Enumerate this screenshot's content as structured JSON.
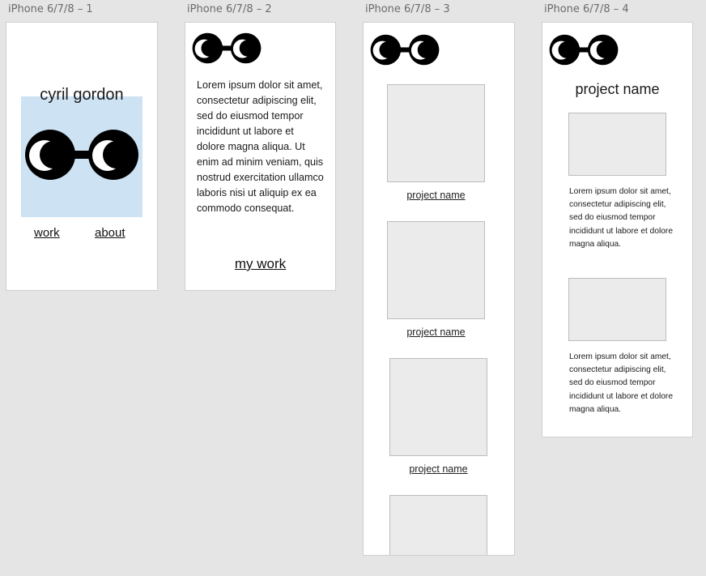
{
  "artboards": [
    {
      "label": "iPhone 6/7/8 – 1"
    },
    {
      "label": "iPhone 6/7/8 – 2"
    },
    {
      "label": "iPhone 6/7/8 – 3"
    },
    {
      "label": "iPhone 6/7/8 – 4"
    }
  ],
  "home": {
    "name": "cyril gordon",
    "nav": {
      "work": "work",
      "about": "about"
    },
    "hero_color": "#cde3f4"
  },
  "about": {
    "bio": "Lorem ipsum dolor sit amet, consectetur adipiscing elit, sed do eiusmod tempor incididunt ut labore et dolore magna aliqua. Ut enim ad minim veniam, quis nostrud exercitation ullamco laboris nisi ut aliquip ex ea commodo consequat.",
    "cta": "my work"
  },
  "work": {
    "projects": [
      {
        "label": "project name"
      },
      {
        "label": "project name"
      },
      {
        "label": "project name"
      }
    ]
  },
  "project": {
    "title": "project name",
    "descriptions": [
      "Lorem ipsum dolor sit amet, consectetur adipiscing elit, sed do eiusmod tempor incididunt ut labore et dolore magna aliqua.",
      "Lorem ipsum dolor sit amet, consectetur adipiscing elit, sed do eiusmod tempor incididunt ut labore et dolore magna aliqua."
    ]
  },
  "icons": {
    "logo": "glasses-icon"
  },
  "colors": {
    "canvas": "#e5e5e5",
    "placeholder": "#ebebeb",
    "logo": "#000000"
  }
}
